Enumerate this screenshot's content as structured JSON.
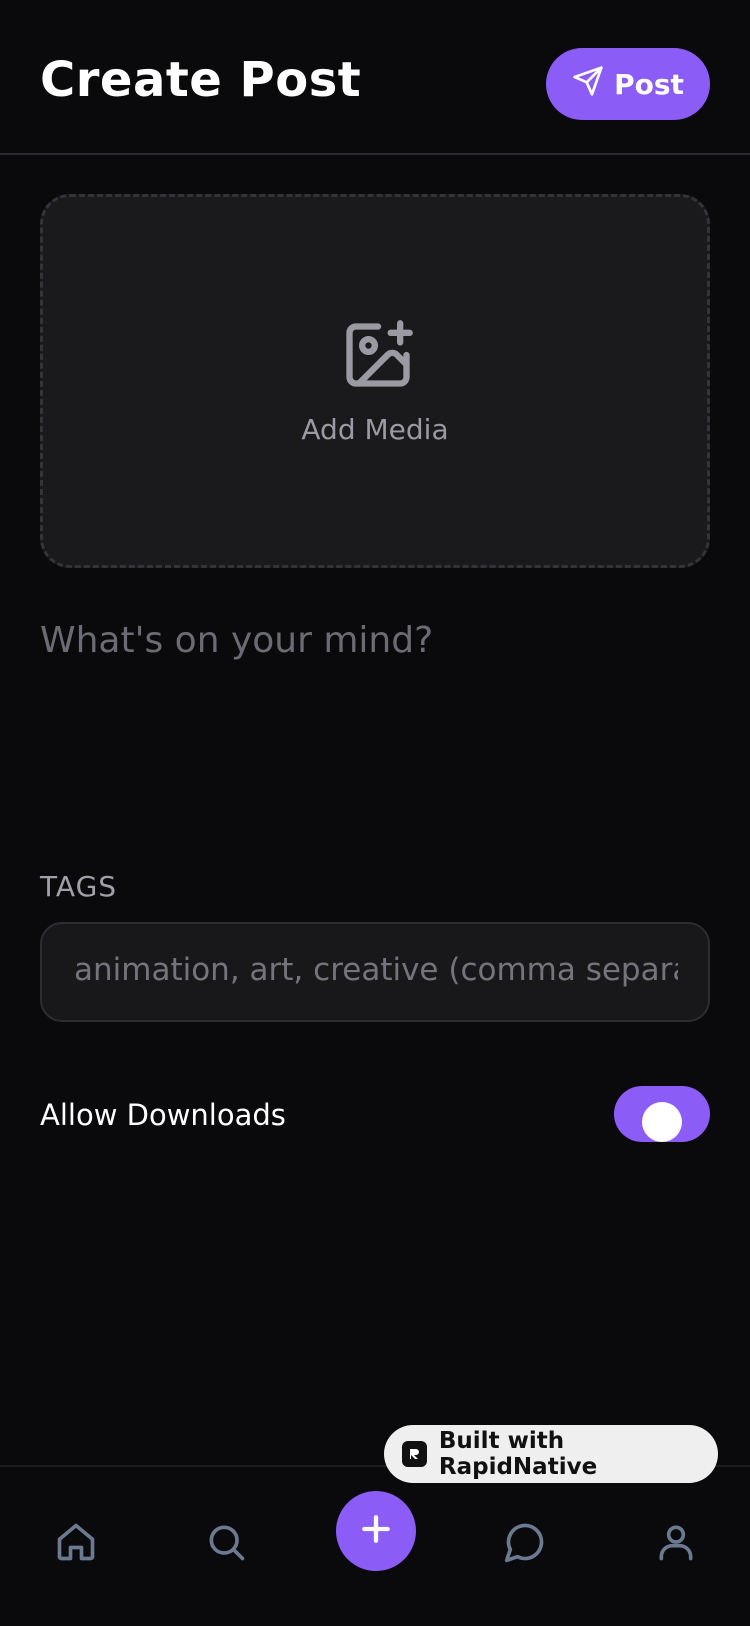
{
  "header": {
    "title": "Create Post",
    "post_label": "Post"
  },
  "media": {
    "label": "Add Media",
    "icon": "image-plus-icon"
  },
  "caption": {
    "placeholder": "What's on your mind?"
  },
  "tags": {
    "label": "TAGS",
    "placeholder": "animation, art, creative (comma separated)"
  },
  "downloads": {
    "label": "Allow Downloads",
    "enabled": true
  },
  "badge": {
    "label": "Built with RapidNative"
  },
  "nav": {
    "items": [
      "home-icon",
      "search-icon",
      "plus-icon",
      "chat-icon",
      "profile-icon"
    ]
  },
  "colors": {
    "accent": "#8b5cf6",
    "background": "#0a0a0d",
    "surface": "#1a1a1d"
  }
}
